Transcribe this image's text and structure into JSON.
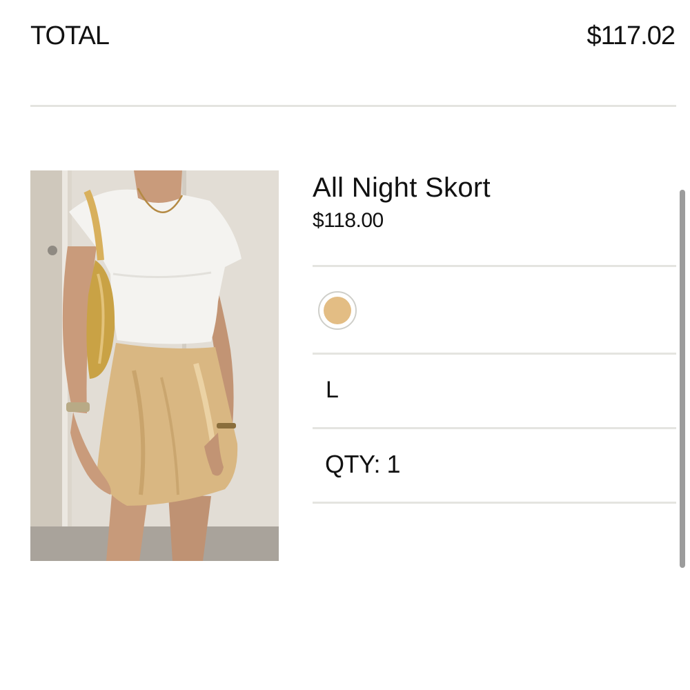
{
  "summary": {
    "total_label": "TOTAL",
    "total_value": "$117.02"
  },
  "product": {
    "name": "All Night Skort",
    "price": "$118.00",
    "color_swatch": "#e3bd84",
    "size": "L",
    "quantity_label": "QTY: 1"
  },
  "colors": {
    "divider": "#e4e4e0",
    "text": "#111111",
    "scrollbar": "#9c9c9c"
  }
}
